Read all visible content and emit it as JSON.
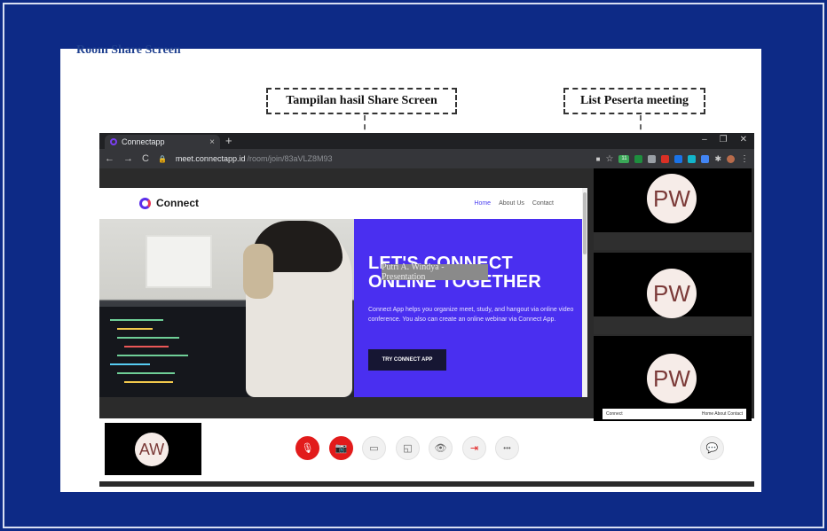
{
  "document": {
    "section_title": "Room Share Screen",
    "callout_share": "Tampilan hasil Share Screen",
    "callout_participants": "List Peserta meeting"
  },
  "browser": {
    "tab_title": "Connectapp",
    "tab_close": "×",
    "new_tab": "+",
    "window_controls": [
      "–",
      "❐",
      "✕"
    ],
    "url_host": "meet.connectapp.id",
    "url_path": "/room/join/83aVLZ8M93",
    "extensions_badge": "11"
  },
  "shared_screen": {
    "logo": "Connect",
    "nav": [
      "Home",
      "About Us",
      "Contact"
    ],
    "hero_title_line1": "LET'S CONNECT",
    "hero_title_line2": "ONLINE TOGETHER",
    "hero_text": "Connect App helps you organize meet, study, and hangout via online video conference. You also can create an online webinar via Connect App.",
    "cta": "TRY CONNECT APP",
    "presenter_label": "Putri A. Windya - Presentation"
  },
  "participants": [
    {
      "initials": "PW"
    },
    {
      "initials": "PW"
    },
    {
      "initials": "PW"
    }
  ],
  "participant_mini_strip": {
    "left": "Connect",
    "right": "Home  About  Contact"
  },
  "self_view": {
    "initials": "AW"
  },
  "controls": {
    "mic_icon": "🎙",
    "camera_icon": "📷",
    "screen_icon": "▭",
    "whiteboard_icon": "◱",
    "view_icon": "👁",
    "leave_icon": "⇥",
    "more_icon": "•••",
    "chat_icon": "💬"
  },
  "colors": {
    "background": "#0d2a86",
    "accent_purple": "#4a2ff0",
    "control_red": "#e21b1b"
  }
}
